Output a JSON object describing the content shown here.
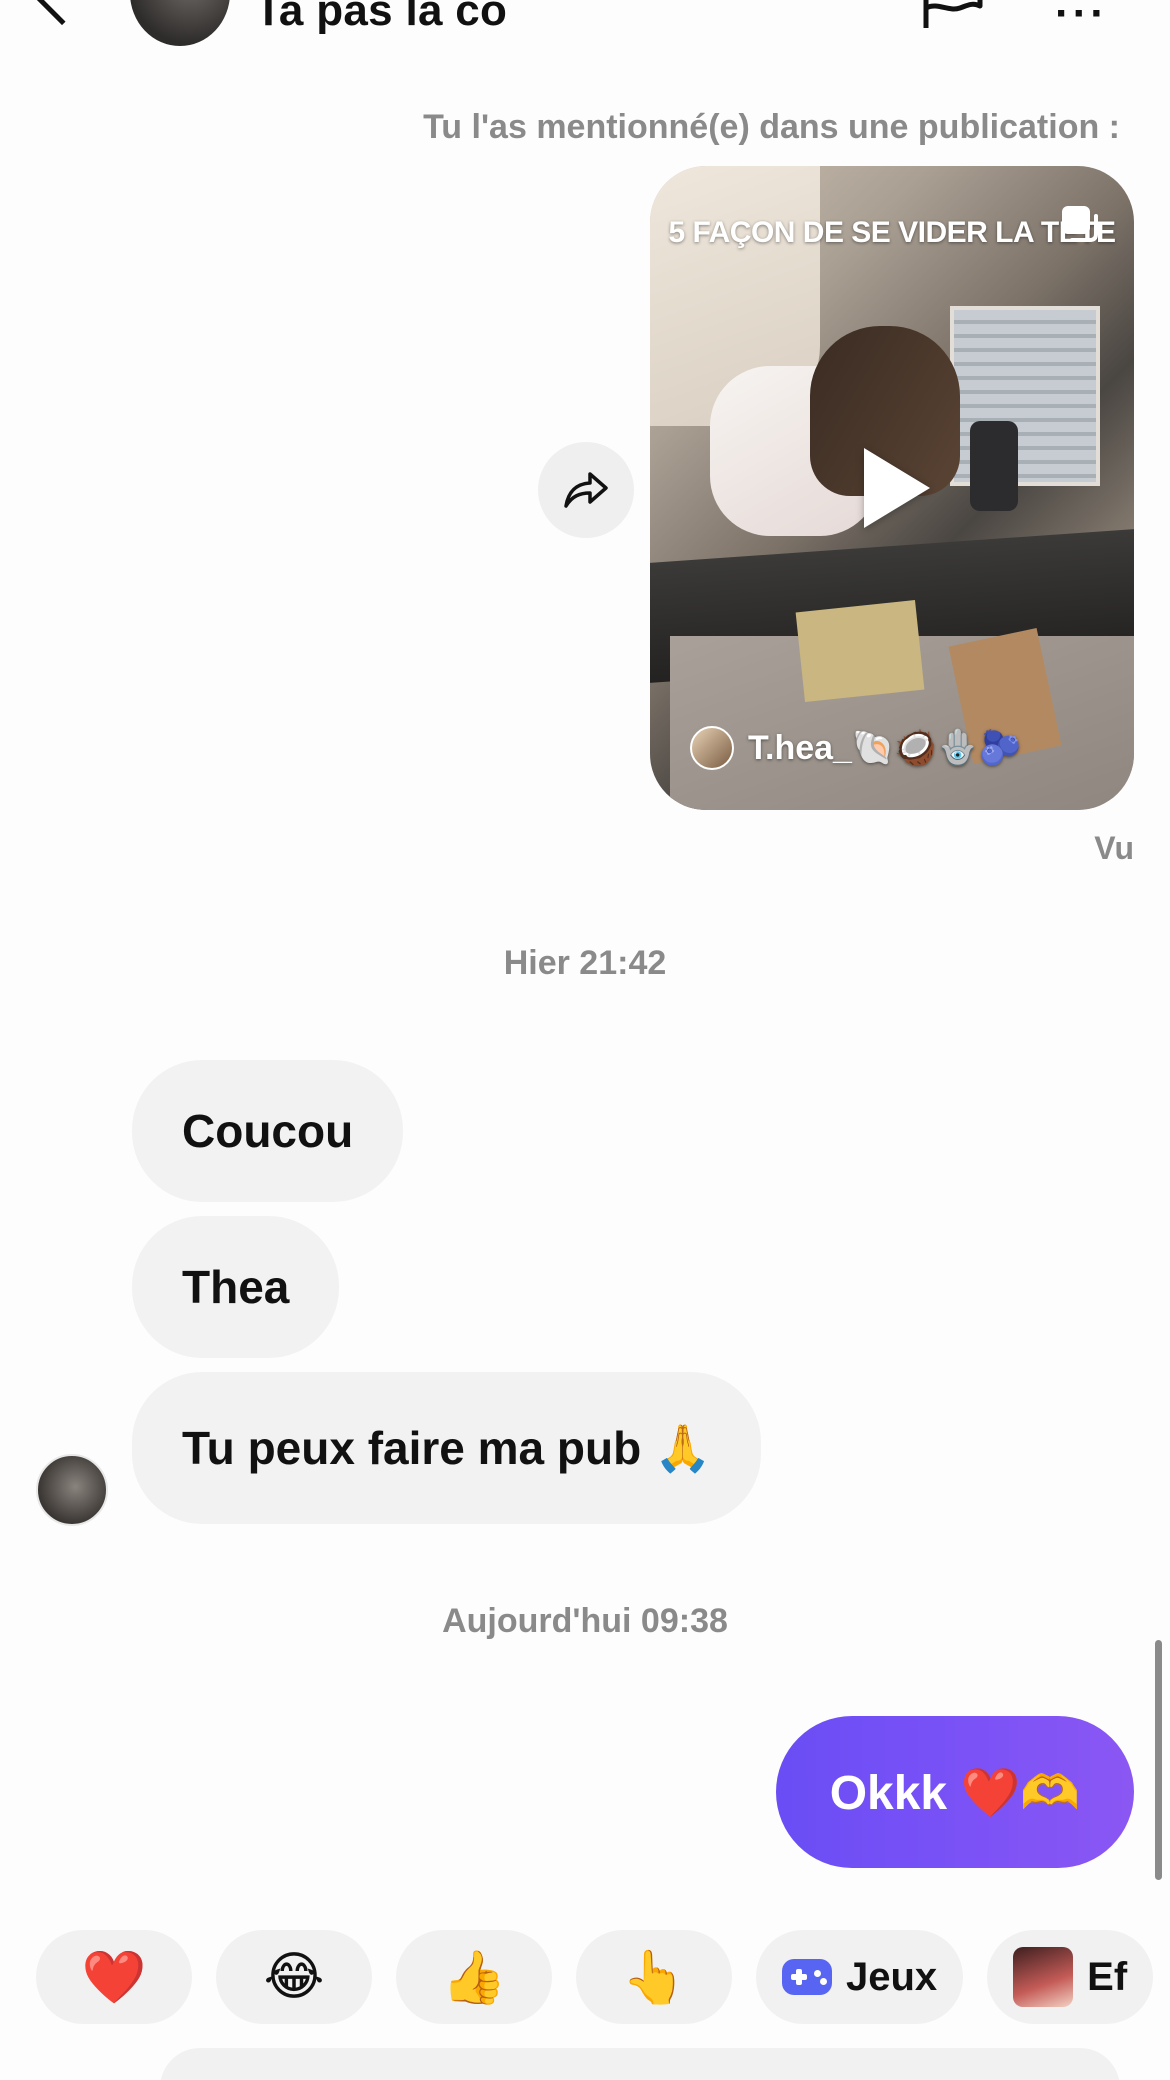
{
  "header": {
    "title": "Ta pas la co",
    "back_icon": "chevron-left-icon",
    "flag_icon": "flag-icon",
    "more_icon": "more-horizontal-icon",
    "more_label": "···"
  },
  "conversation": {
    "mention_note": "Tu l'as mentionné(e) dans une publication :",
    "shared_video": {
      "title": "5 FAÇON DE SE VIDER LA TÊTE",
      "author": "T.hea_🐚🥥🪬🫐"
    },
    "seen_label": "Vu",
    "timestamp_1": "Hier 21:42",
    "incoming_messages": [
      {
        "text": "Coucou"
      },
      {
        "text": "Thea"
      },
      {
        "text": "Tu peux faire ma pub 🙏"
      }
    ],
    "timestamp_2": "Aujourd'hui 09:38",
    "outgoing_message": {
      "text": "Okkk ❤️🫶"
    },
    "accent_color": "#6a4df5"
  },
  "quick_reactions": {
    "emojis": [
      "❤️",
      "😂",
      "👍",
      "👆"
    ],
    "games_label": "Jeux",
    "effects_label": "Ef"
  }
}
